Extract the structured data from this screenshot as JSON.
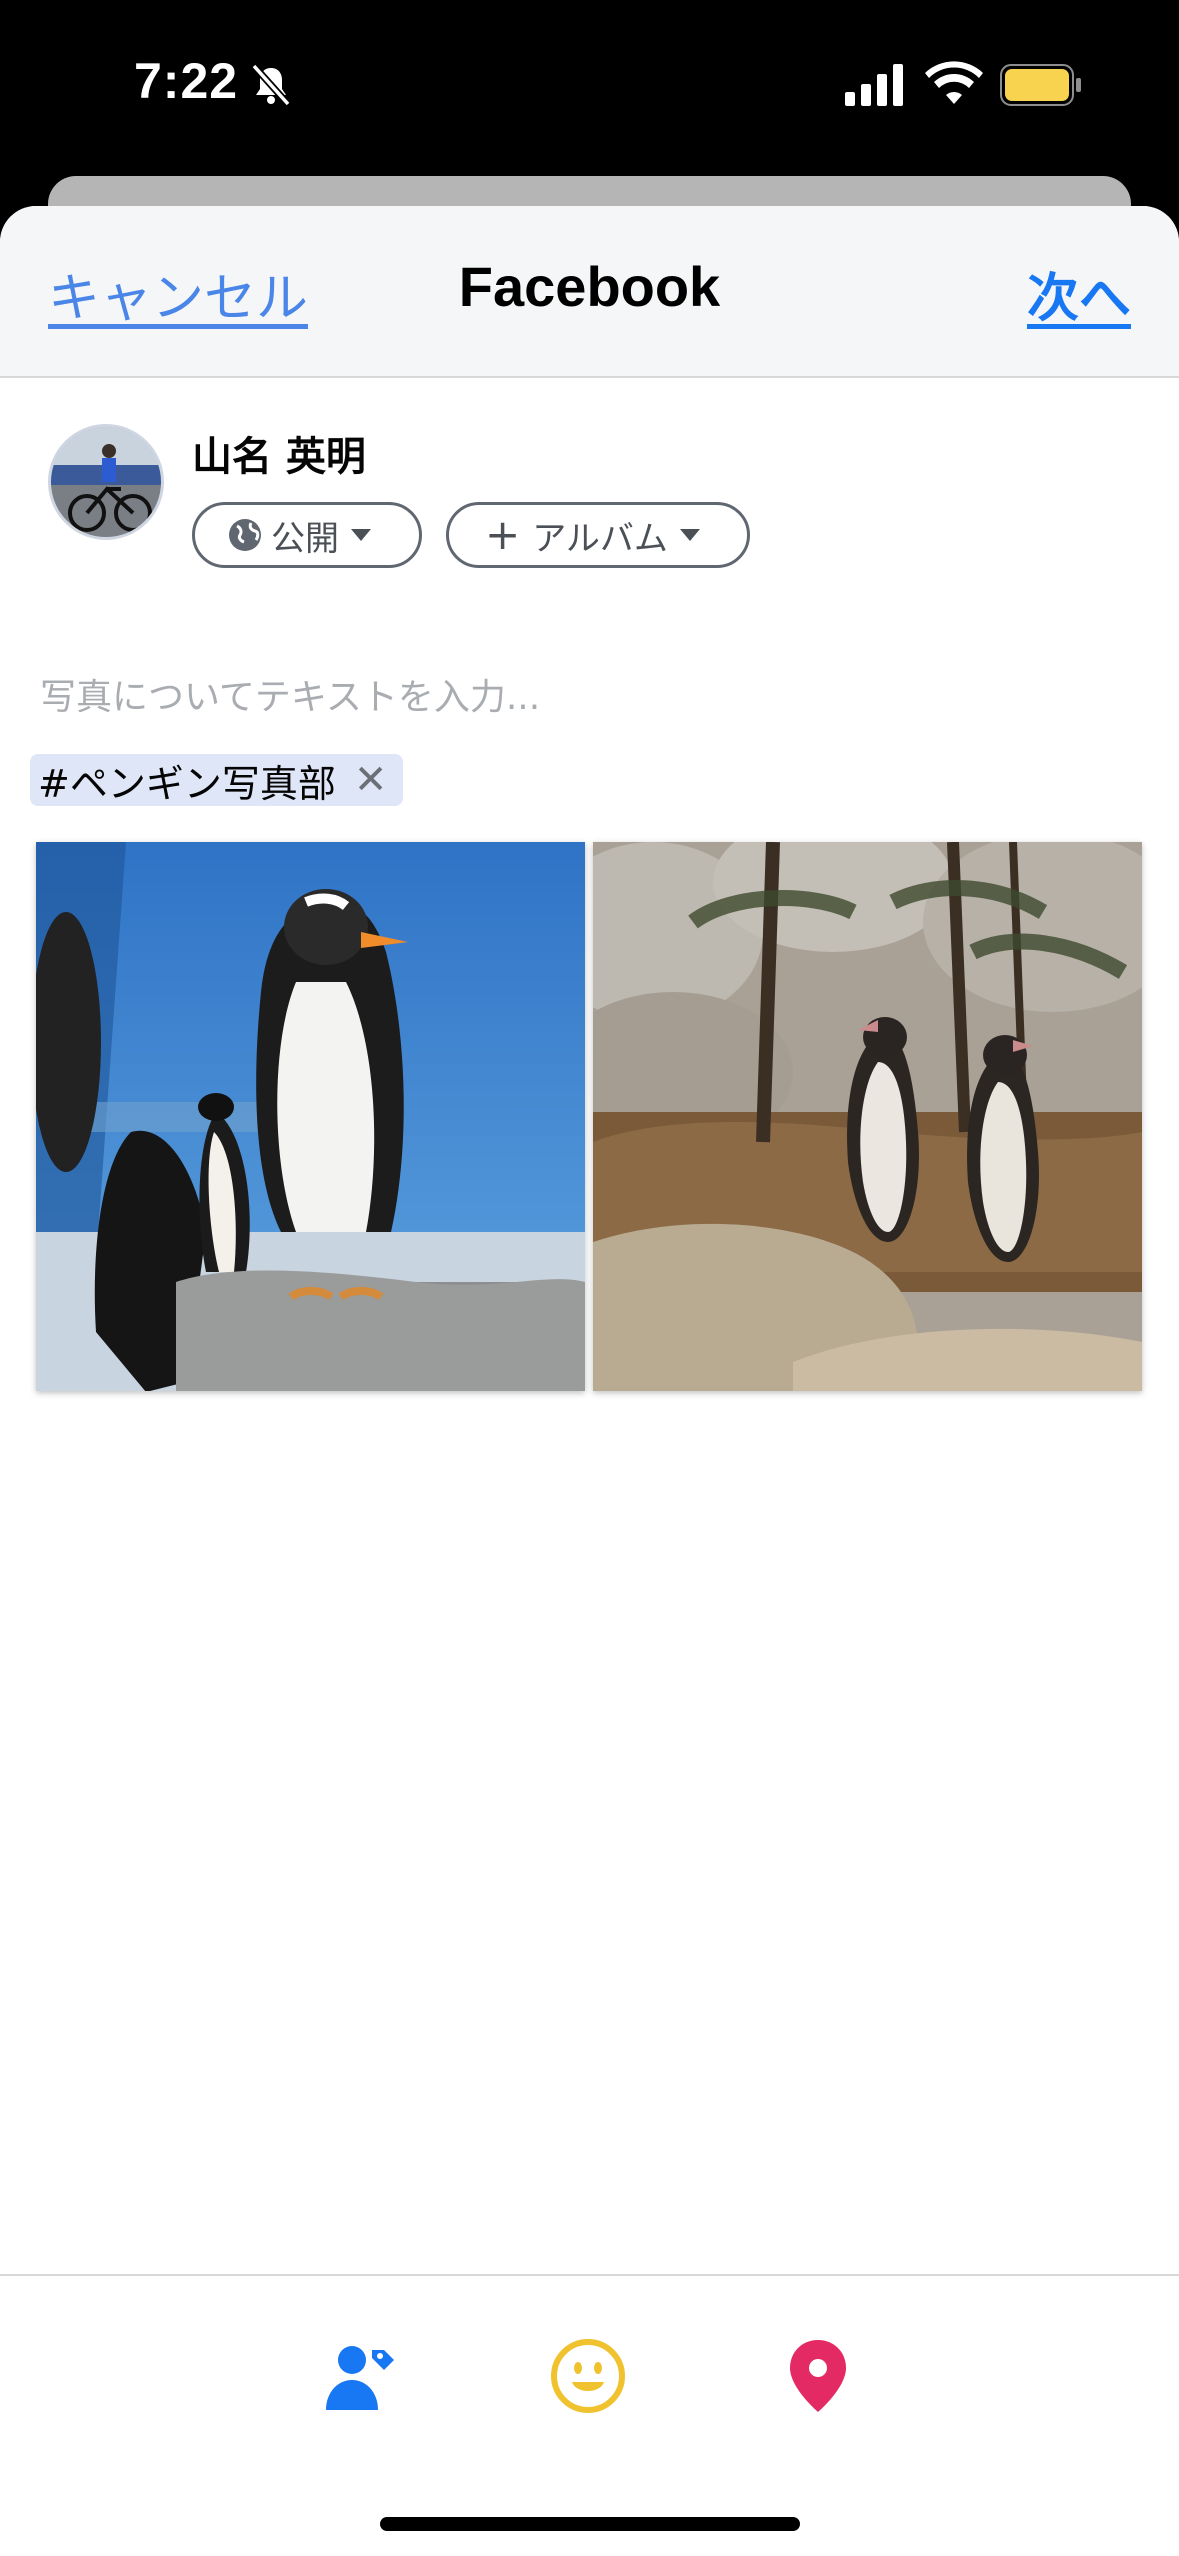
{
  "status_bar": {
    "time": "7:22"
  },
  "nav": {
    "cancel": "キャンセル",
    "title": "Facebook",
    "next": "次へ"
  },
  "user": {
    "name": "山名 英明"
  },
  "privacy": {
    "label": "公開"
  },
  "album": {
    "label": "アルバム"
  },
  "post": {
    "placeholder": "写真についてテキストを入力..."
  },
  "hashtag": {
    "text": "#ペンギン写真部",
    "close": "✕"
  },
  "photos": [
    {
      "subject": "penguins-aquarium"
    },
    {
      "subject": "penguins-rocks"
    }
  ],
  "toolbar": {
    "icons": [
      "tag-people-icon",
      "feeling-icon",
      "location-icon"
    ],
    "colors": {
      "tag": "#1877f2",
      "feeling": "#f0c22e",
      "location": "#e42a64"
    }
  },
  "colors": {
    "accent": "#1877f2",
    "nav_bg": "#f5f6f7",
    "chip_bg": "#dfe6f7"
  }
}
